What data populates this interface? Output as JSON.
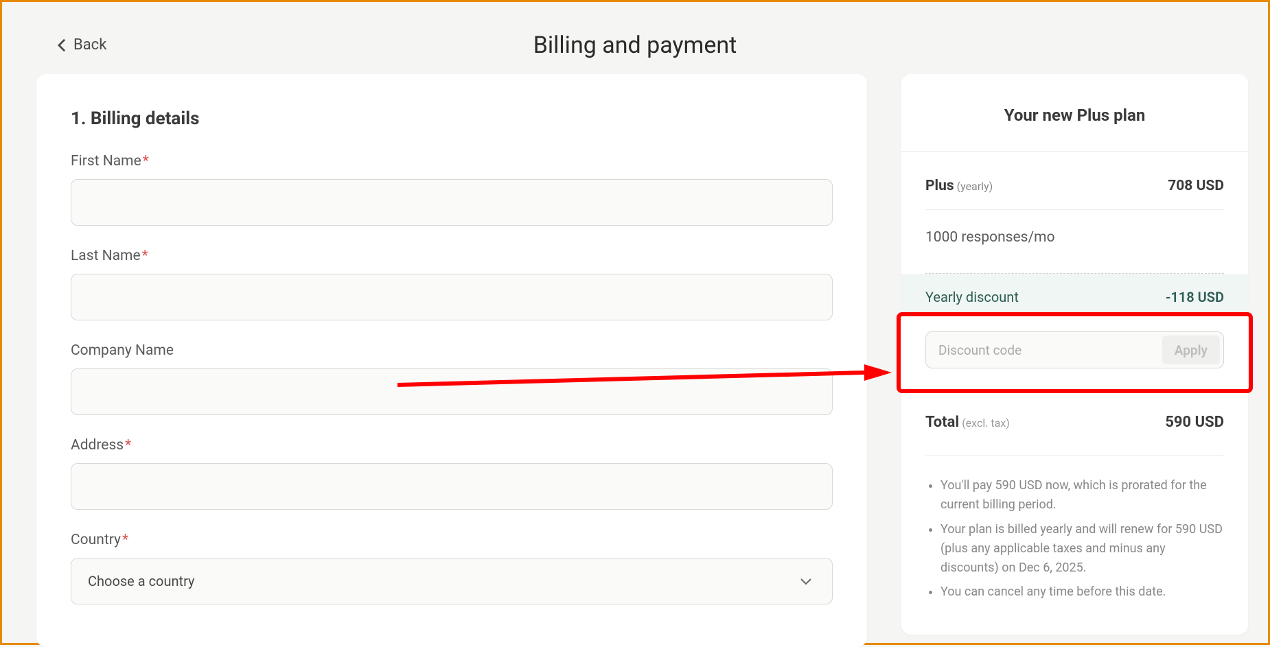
{
  "header": {
    "back_label": "Back",
    "page_title": "Billing and payment"
  },
  "billing": {
    "heading": "1. Billing details",
    "fields": {
      "first_name_label": "First Name",
      "last_name_label": "Last Name",
      "company_name_label": "Company Name",
      "address_label": "Address",
      "country_label": "Country",
      "country_placeholder": "Choose a country"
    }
  },
  "summary": {
    "title": "Your new Plus plan",
    "plan_name": "Plus",
    "plan_period": "(yearly)",
    "plan_price": "708 USD",
    "responses_line": "1000 responses/mo",
    "discount_label": "Yearly discount",
    "discount_value": "-118 USD",
    "discount_code_placeholder": "Discount code",
    "apply_label": "Apply",
    "total_label": "Total",
    "total_sublabel": "(excl. tax)",
    "total_value": "590 USD",
    "notes": [
      "You'll pay 590 USD now, which is prorated for the current billing period.",
      "Your plan is billed yearly and will renew for 590 USD (plus any applicable taxes and minus any discounts) on Dec 6, 2025.",
      "You can cancel any time before this date."
    ]
  }
}
